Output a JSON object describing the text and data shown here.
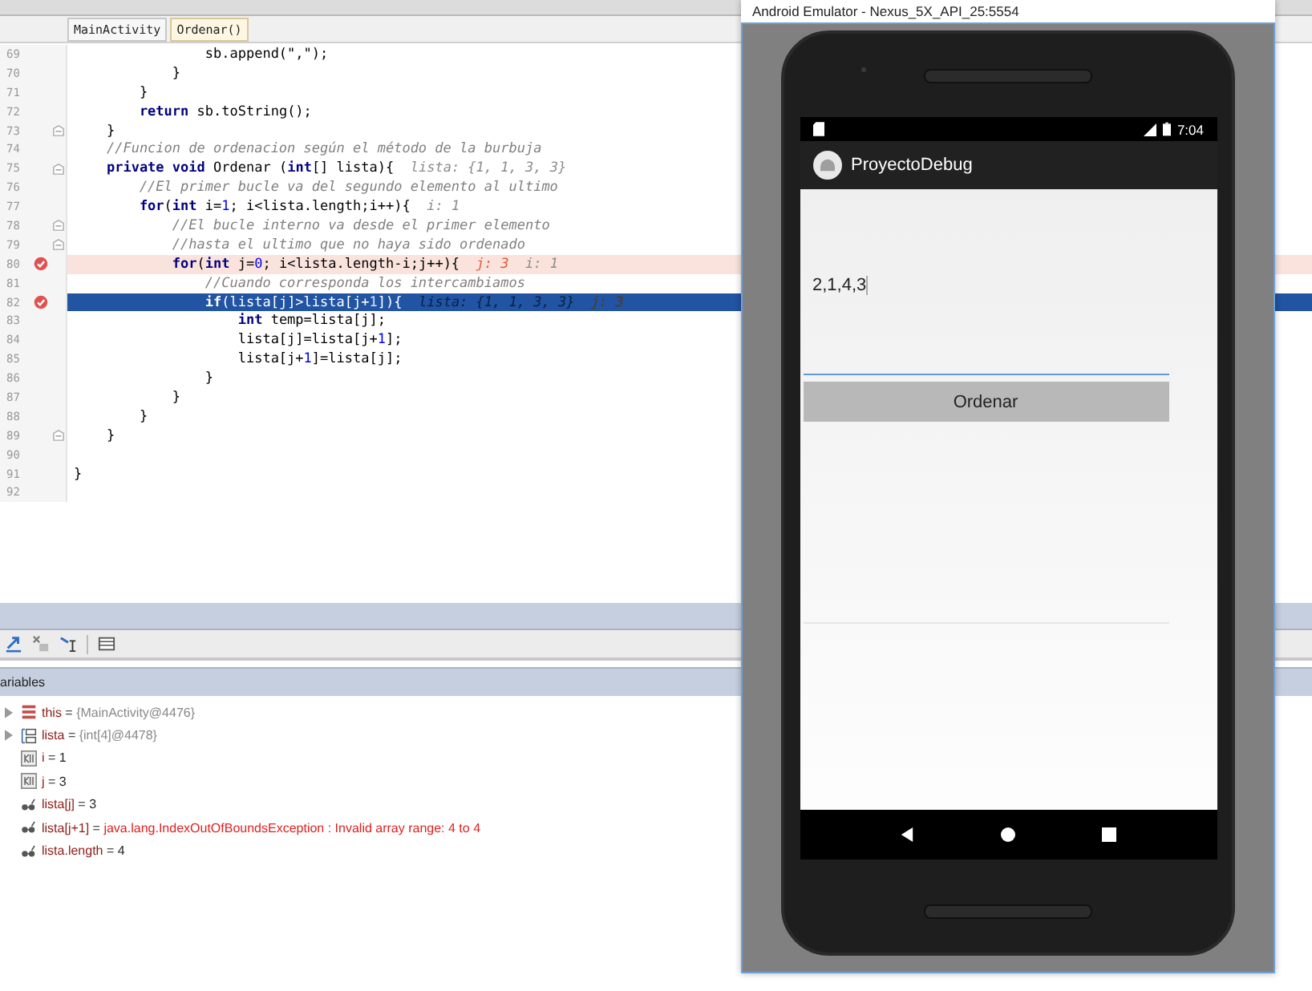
{
  "breadcrumbs": [
    {
      "label": "MainActivity",
      "selected": false
    },
    {
      "label": "Ordenar()",
      "selected": true
    }
  ],
  "code_lines": [
    {
      "number": "69",
      "breakpoint": false,
      "current": false,
      "fold": false,
      "segments": [
        {
          "kind": "text",
          "text": "                sb.append(\",\");"
        }
      ]
    },
    {
      "number": "70",
      "breakpoint": false,
      "current": false,
      "fold": false,
      "segments": [
        {
          "kind": "text",
          "text": "            }"
        }
      ]
    },
    {
      "number": "71",
      "breakpoint": false,
      "current": false,
      "fold": false,
      "segments": [
        {
          "kind": "text",
          "text": "        }"
        }
      ]
    },
    {
      "number": "72",
      "breakpoint": false,
      "current": false,
      "fold": false,
      "segments": [
        {
          "kind": "kw",
          "text": "        return"
        },
        {
          "kind": "text",
          "text": " sb.toString();"
        }
      ]
    },
    {
      "number": "73",
      "breakpoint": false,
      "current": false,
      "fold": true,
      "segments": [
        {
          "kind": "text",
          "text": "    }"
        }
      ]
    },
    {
      "number": "74",
      "breakpoint": false,
      "current": false,
      "fold": false,
      "segments": [
        {
          "kind": "comment",
          "text": "    //Funcion de ordenacion según el método de la burbuja"
        }
      ]
    },
    {
      "number": "75",
      "breakpoint": false,
      "current": false,
      "fold": true,
      "segments": [
        {
          "kind": "kw",
          "text": "    private void"
        },
        {
          "kind": "text",
          "text": " Ordenar ("
        },
        {
          "kind": "kw",
          "text": "int"
        },
        {
          "kind": "text",
          "text": "[] lista){"
        },
        {
          "kind": "hint",
          "text": "  lista: {1, 1, 3, 3}"
        }
      ]
    },
    {
      "number": "76",
      "breakpoint": false,
      "current": false,
      "fold": false,
      "segments": [
        {
          "kind": "comment",
          "text": "        //El primer bucle va del segundo elemento al ultimo"
        }
      ]
    },
    {
      "number": "77",
      "breakpoint": false,
      "current": false,
      "fold": false,
      "segments": [
        {
          "kind": "kw",
          "text": "        for"
        },
        {
          "kind": "text",
          "text": "("
        },
        {
          "kind": "kw",
          "text": "int"
        },
        {
          "kind": "text",
          "text": " i="
        },
        {
          "kind": "num",
          "text": "1"
        },
        {
          "kind": "text",
          "text": "; i<lista.length;i++){"
        },
        {
          "kind": "hint",
          "text": "  i: 1"
        }
      ]
    },
    {
      "number": "78",
      "breakpoint": false,
      "current": false,
      "fold": true,
      "segments": [
        {
          "kind": "comment",
          "text": "            //El bucle interno va desde el primer elemento"
        }
      ]
    },
    {
      "number": "79",
      "breakpoint": false,
      "current": false,
      "fold": true,
      "segments": [
        {
          "kind": "comment",
          "text": "            //hasta el ultimo que no haya sido ordenado"
        }
      ]
    },
    {
      "number": "80",
      "breakpoint": true,
      "current": false,
      "fold": false,
      "segments": [
        {
          "kind": "kw",
          "text": "            for"
        },
        {
          "kind": "text",
          "text": "("
        },
        {
          "kind": "kw",
          "text": "int"
        },
        {
          "kind": "text",
          "text": " j="
        },
        {
          "kind": "num",
          "text": "0"
        },
        {
          "kind": "text",
          "text": "; i<lista.length-i;j++){"
        },
        {
          "kind": "changed",
          "text": "  j: 3"
        },
        {
          "kind": "hint",
          "text": "  i: 1"
        }
      ]
    },
    {
      "number": "81",
      "breakpoint": false,
      "current": false,
      "fold": false,
      "segments": [
        {
          "kind": "comment",
          "text": "                //Cuando corresponda los intercambiamos"
        }
      ]
    },
    {
      "number": "82",
      "breakpoint": true,
      "current": true,
      "fold": false,
      "segments": [
        {
          "kind": "kw",
          "text": "                if"
        },
        {
          "kind": "text",
          "text": "(lista[j]>lista[j+"
        },
        {
          "kind": "num",
          "text": "1"
        },
        {
          "kind": "text",
          "text": "]){"
        },
        {
          "kind": "hint",
          "text": "  lista: {1, 1, 3, 3}"
        },
        {
          "kind": "changed",
          "text": "  j: 3"
        }
      ]
    },
    {
      "number": "83",
      "breakpoint": false,
      "current": false,
      "fold": false,
      "segments": [
        {
          "kind": "kw",
          "text": "                    int"
        },
        {
          "kind": "text",
          "text": " temp=lista[j];"
        }
      ]
    },
    {
      "number": "84",
      "breakpoint": false,
      "current": false,
      "fold": false,
      "segments": [
        {
          "kind": "text",
          "text": "                    lista[j]=lista[j+"
        },
        {
          "kind": "num",
          "text": "1"
        },
        {
          "kind": "text",
          "text": "];"
        }
      ]
    },
    {
      "number": "85",
      "breakpoint": false,
      "current": false,
      "fold": false,
      "segments": [
        {
          "kind": "text",
          "text": "                    lista[j+"
        },
        {
          "kind": "num",
          "text": "1"
        },
        {
          "kind": "text",
          "text": "]=lista[j];"
        }
      ]
    },
    {
      "number": "86",
      "breakpoint": false,
      "current": false,
      "fold": false,
      "segments": [
        {
          "kind": "text",
          "text": "                }"
        }
      ]
    },
    {
      "number": "87",
      "breakpoint": false,
      "current": false,
      "fold": false,
      "segments": [
        {
          "kind": "text",
          "text": "            }"
        }
      ]
    },
    {
      "number": "88",
      "breakpoint": false,
      "current": false,
      "fold": false,
      "segments": [
        {
          "kind": "text",
          "text": "        }"
        }
      ]
    },
    {
      "number": "89",
      "breakpoint": false,
      "current": false,
      "fold": true,
      "segments": [
        {
          "kind": "text",
          "text": "    }"
        }
      ]
    },
    {
      "number": "90",
      "breakpoint": false,
      "current": false,
      "fold": false
    },
    {
      "number": "91",
      "breakpoint": false,
      "current": false,
      "fold": false,
      "segments": [
        {
          "kind": "text",
          "text": "}"
        }
      ]
    },
    {
      "number": "92",
      "breakpoint": false,
      "current": false,
      "fold": false
    }
  ],
  "variables_panel": {
    "title": "ariables",
    "variables": [
      {
        "kind": "object",
        "expandable": true,
        "name": "this",
        "operator": "=",
        "value": "{MainActivity@4476}",
        "error": false
      },
      {
        "kind": "array",
        "expandable": true,
        "name": "lista",
        "operator": "=",
        "value": "{int[4]@4478}",
        "error": false
      },
      {
        "kind": "primitive",
        "expandable": false,
        "name": "i",
        "operator": "=",
        "value": "1",
        "error": false
      },
      {
        "kind": "primitive",
        "expandable": false,
        "name": "j",
        "operator": "=",
        "value": "3",
        "error": false
      },
      {
        "kind": "watch",
        "expandable": false,
        "name": "lista[j]",
        "operator": "=",
        "value": "3",
        "error": false
      },
      {
        "kind": "watch",
        "expandable": false,
        "name": "lista[j+1]",
        "operator": "=",
        "value": "java.lang.IndexOutOfBoundsException : Invalid array range: 4 to 4",
        "error": true
      },
      {
        "kind": "watch",
        "expandable": false,
        "name": "lista.length",
        "operator": "=",
        "value": "4",
        "error": false
      }
    ]
  },
  "emulator": {
    "title": "Android Emulator - Nexus_5X_API_25:5554",
    "status_bar": {
      "time": "7:04"
    },
    "app_bar": {
      "title": "ProyectoDebug"
    },
    "input": {
      "value": "2,1,4,3"
    },
    "button": "Ordenar"
  }
}
